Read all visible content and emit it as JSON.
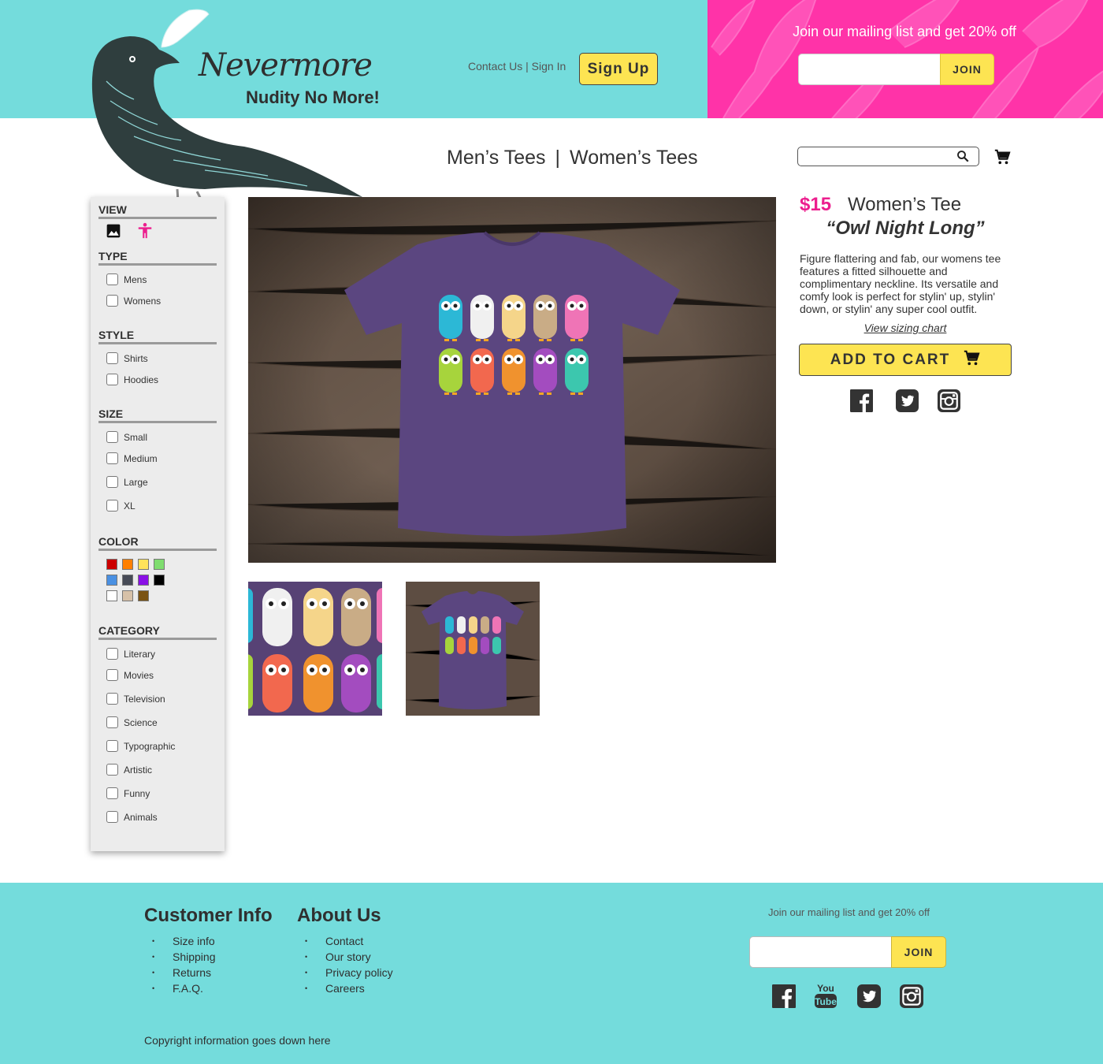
{
  "brand": {
    "name": "Nevermore",
    "tagline": "Nudity No More!"
  },
  "header": {
    "contact_label": "Contact Us",
    "separator": "|",
    "signin_label": "Sign In",
    "signup_label": "Sign Up",
    "promo_text": "Join our mailing list and get 20% off",
    "promo_input_placeholder": "",
    "promo_join_label": "JOIN",
    "promo_background_color": "#ff33a8"
  },
  "nav": {
    "mens_label": "Men’s Tees",
    "separator": "|",
    "womens_label": "Women’s Tees",
    "search_placeholder": "",
    "search_icon": "search-icon",
    "cart_icon": "cart-icon"
  },
  "sidebar": {
    "view_title": "VIEW",
    "view_icons": [
      "image-icon",
      "person-icon"
    ],
    "type_title": "TYPE",
    "type_options": [
      "Mens",
      "Womens"
    ],
    "style_title": "STYLE",
    "style_options": [
      "Shirts",
      "Hoodies"
    ],
    "size_title": "SIZE",
    "size_options": [
      "Small",
      "Medium",
      "Large",
      "XL"
    ],
    "color_title": "COLOR",
    "colors": [
      "#cc0000",
      "#ff8000",
      "#ffe35a",
      "#7fdd6f",
      "#4a90e2",
      "#474b56",
      "#8a10e6",
      "#000000",
      "#ffffff",
      "#d7c1a8",
      "#7a5313"
    ],
    "category_title": "CATEGORY",
    "category_options": [
      "Literary",
      "Movies",
      "Television",
      "Science",
      "Typographic",
      "Artistic",
      "Funny",
      "Animals"
    ]
  },
  "product": {
    "price": "$15",
    "type": "Women’s Tee",
    "name": "“Owl Night Long”",
    "description": "Figure flattering and fab, our womens tee features a fitted silhouette and complimentary neckline. Its versatile and comfy look is perfect for stylin' up, stylin' down, or stylin' any super cool outfit.",
    "sizing_link": "View sizing chart",
    "add_to_cart_label": "ADD TO CART",
    "shirt_color": "#5b4680",
    "social_icons": [
      "facebook-icon",
      "twitter-icon",
      "instagram-icon"
    ]
  },
  "footer": {
    "customer_info_title": "Customer Info",
    "customer_info_links": [
      "Size info",
      "Shipping",
      "Returns",
      "F.A.Q."
    ],
    "about_title": "About Us",
    "about_links": [
      "Contact",
      "Our story",
      "Privacy policy",
      "Careers"
    ],
    "mail_text": "Join our mailing list and get 20% off",
    "join_label": "JOIN",
    "social_icons": [
      "facebook-icon",
      "youtube-icon",
      "twitter-icon",
      "instagram-icon"
    ],
    "youtube_you": "You",
    "youtube_tube": "Tube",
    "copyright": "Copyright information goes down here"
  },
  "accent_colors": {
    "header_teal": "#74dcdc",
    "button_yellow": "#fde452",
    "price_pink": "#ec1e8e"
  }
}
